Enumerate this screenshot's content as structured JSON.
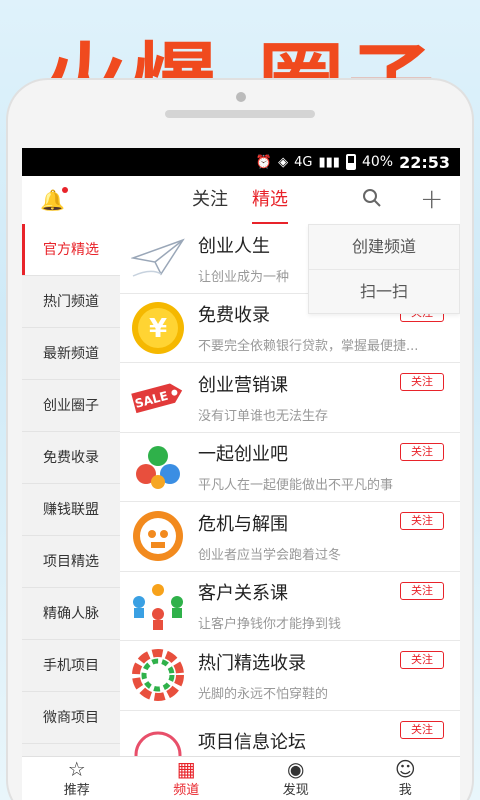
{
  "banner": {
    "left": "火爆",
    "right": "圈子"
  },
  "status": {
    "network": "4G",
    "battery": "40%",
    "time": "22:53"
  },
  "topbar": {
    "tabs": [
      {
        "label": "关注"
      },
      {
        "label": "精选"
      }
    ]
  },
  "dropdown": {
    "items": [
      {
        "label": "创建频道"
      },
      {
        "label": "扫一扫"
      }
    ]
  },
  "sidebar": {
    "items": [
      {
        "label": "官方精选"
      },
      {
        "label": "热门频道"
      },
      {
        "label": "最新频道"
      },
      {
        "label": "创业圈子"
      },
      {
        "label": "免费收录"
      },
      {
        "label": "赚钱联盟"
      },
      {
        "label": "项目精选"
      },
      {
        "label": "精确人脉"
      },
      {
        "label": "手机项目"
      },
      {
        "label": "微商项目"
      }
    ]
  },
  "list": {
    "rows": [
      {
        "title": "创业人生",
        "desc": "让创业成为一种",
        "follow": "",
        "icon": "paper-plane-icon"
      },
      {
        "title": "免费收录",
        "desc": "不要完全依赖银行贷款，掌握最便捷...",
        "follow": "关注",
        "icon": "yen-coin-icon"
      },
      {
        "title": "创业营销课",
        "desc": "没有订单谁也无法生存",
        "follow": "关注",
        "icon": "sale-tag-icon"
      },
      {
        "title": "一起创业吧",
        "desc": "平凡人在一起便能做出不平凡的事",
        "follow": "关注",
        "icon": "social-apps-icon"
      },
      {
        "title": "危机与解围",
        "desc": "创业者应当学会跑着过冬",
        "follow": "关注",
        "icon": "skull-icon"
      },
      {
        "title": "客户关系课",
        "desc": "让客户挣钱你才能挣到钱",
        "follow": "关注",
        "icon": "people-network-icon"
      },
      {
        "title": "热门精选收录",
        "desc": "光脚的永远不怕穿鞋的",
        "follow": "关注",
        "icon": "people-circle-icon"
      },
      {
        "title": "项目信息论坛",
        "desc": "",
        "follow": "关注",
        "icon": "forum-icon"
      }
    ]
  },
  "bottomnav": {
    "items": [
      {
        "label": "推荐",
        "icon": "star-icon"
      },
      {
        "label": "频道",
        "icon": "grid-icon"
      },
      {
        "label": "发现",
        "icon": "eye-icon"
      },
      {
        "label": "我",
        "icon": "person-icon"
      }
    ]
  },
  "colors": {
    "accent": "#e8232a",
    "banner": "#f04a1e"
  }
}
